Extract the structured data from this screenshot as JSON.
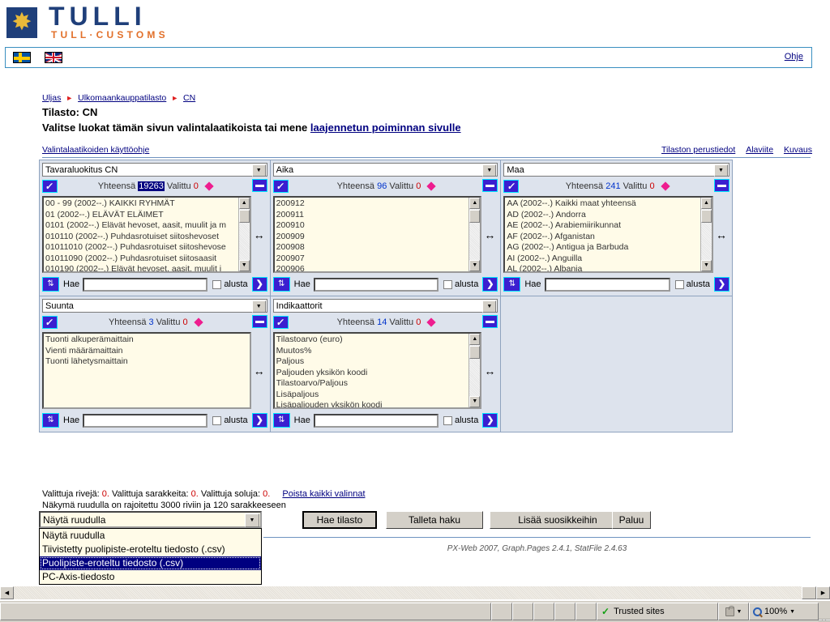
{
  "header": {
    "logo_primary": "TULLI",
    "logo_secondary": "TULL·CUSTOMS",
    "logo_icon": "customs-caduceus-icon"
  },
  "langbar": {
    "flag_se": "swedish-flag-icon",
    "flag_gb": "english-flag-icon",
    "help_link": "Ohje"
  },
  "breadcrumb": {
    "items": [
      "Uljas",
      "Ulkomaankauppatilasto",
      "CN"
    ]
  },
  "titles": {
    "line1": "Tilasto: CN",
    "line2_prefix": "Valitse luokat tämän sivun valintalaatikoista tai mene ",
    "line2_link": "laajennetun poiminnan sivulle",
    "help_link": "Valintalaatikoiden käyttöohje",
    "right_links": [
      "Tilaston perustiedot",
      "Alaviite",
      "Kuvaus"
    ]
  },
  "labels": {
    "total": "Yhteensä",
    "selected": "Valittu",
    "search": "Hae",
    "reset": "alusta",
    "select_all_icon": "select-all-checkmark-icon",
    "minus_icon": "collapse-minus-icon",
    "sort_icon": "sort-updown-icon",
    "go_icon": "search-go-arrow-icon",
    "hmove_icon": "horizontal-resize-icon",
    "dropdown_icon": "chevron-down-icon",
    "scroll_up_icon": "scroll-up-arrow-icon",
    "scroll_down_icon": "scroll-down-arrow-icon"
  },
  "boxes": [
    {
      "title": "Tavaraluokitus CN",
      "total": "19263",
      "total_highlighted": true,
      "selected": "0",
      "search_value": "",
      "options": [
        "00 - 99 (2002--.) KAIKKI RYHMÄT",
        "01 (2002--.) ELÄVÄT ELÄIMET",
        "0101 (2002--.) Elävät hevoset, aasit, muulit ja m",
        "010110 (2002--.) Puhdasrotuiset siitoshevoset",
        "01011010 (2002--.) Puhdasrotuiset siitoshevose",
        "01011090 (2002--.) Puhdasrotuiset siitosaasit",
        "010190 (2002--.) Elävät hevoset, aasit, muulit j"
      ]
    },
    {
      "title": "Aika",
      "total": "96",
      "total_highlighted": false,
      "selected": "0",
      "search_value": "",
      "options": [
        "200912",
        "200911",
        "200910",
        "200909",
        "200908",
        "200907",
        "200906"
      ]
    },
    {
      "title": "Maa",
      "total": "241",
      "total_highlighted": false,
      "selected": "0",
      "search_value": "",
      "options": [
        "AA (2002--.) Kaikki maat yhteensä",
        "AD (2002--.) Andorra",
        "AE (2002--.) Arabiemiirikunnat",
        "AF (2002--.) Afganistan",
        "AG (2002--.) Antigua ja Barbuda",
        "AI (2002--.) Anguilla",
        "AL (2002--.) Albania"
      ]
    },
    {
      "title": "Suunta",
      "total": "3",
      "total_highlighted": false,
      "selected": "0",
      "search_value": "",
      "options": [
        "Tuonti alkuperämaittain",
        "Vienti määrämaittain",
        "Tuonti lähetysmaittain"
      ]
    },
    {
      "title": "Indikaattorit",
      "total": "14",
      "total_highlighted": false,
      "selected": "0",
      "search_value": "",
      "options": [
        "Tilastoarvo (euro)",
        "Muutos%",
        "Paljous",
        "Paljouden yksikön koodi",
        "Tilastoarvo/Paljous",
        "Lisäpaljous",
        "Lisäpaljouden yksikön koodi"
      ]
    }
  ],
  "status": {
    "rows_label": "Valittuja rivejä:",
    "rows_value": "0.",
    "cols_label": "Valittuja sarakkeita:",
    "cols_value": "0.",
    "cells_label": "Valittuja soluja:",
    "cells_value": "0.",
    "clear_link": "Poista kaikki valinnat",
    "limit_note": "Näkymä ruudulla on rajoitettu 3000 riviin ja 120 sarakkeeseen"
  },
  "actions": {
    "format_selected": "Näytä ruudulla",
    "format_options": [
      "Näytä ruudulla",
      "Tiivistetty puolipiste-eroteltu tiedosto (.csv)",
      "Puolipiste-eroteltu tiedosto (.csv)",
      "PC-Axis-tiedosto"
    ],
    "format_highlighted_index": 2,
    "btn_fetch": "Hae tilasto",
    "btn_save": "Talleta haku",
    "btn_favorite": "Lisää suosikkeihin",
    "btn_back": "Paluu"
  },
  "footer": {
    "version": "PX-Web 2007, Graph.Pages 2.4.1, StatFile 2.4.63"
  },
  "browser": {
    "zone_text": "Trusted sites",
    "zone_icon": "green-check-icon",
    "lock_icon": "security-lock-icon",
    "zoom_icon": "magnifier-zoom-icon",
    "zoom_level": "100%"
  },
  "colors": {
    "brand_blue": "#1f3f7a",
    "brand_orange": "#e2702a",
    "accent_button": "#3b1fd0",
    "accent_border": "#00e5ff",
    "diamond": "#ee1d8f",
    "panel_bg": "#dde3ed",
    "list_bg": "#fffbe8",
    "highlight": "#000080"
  }
}
